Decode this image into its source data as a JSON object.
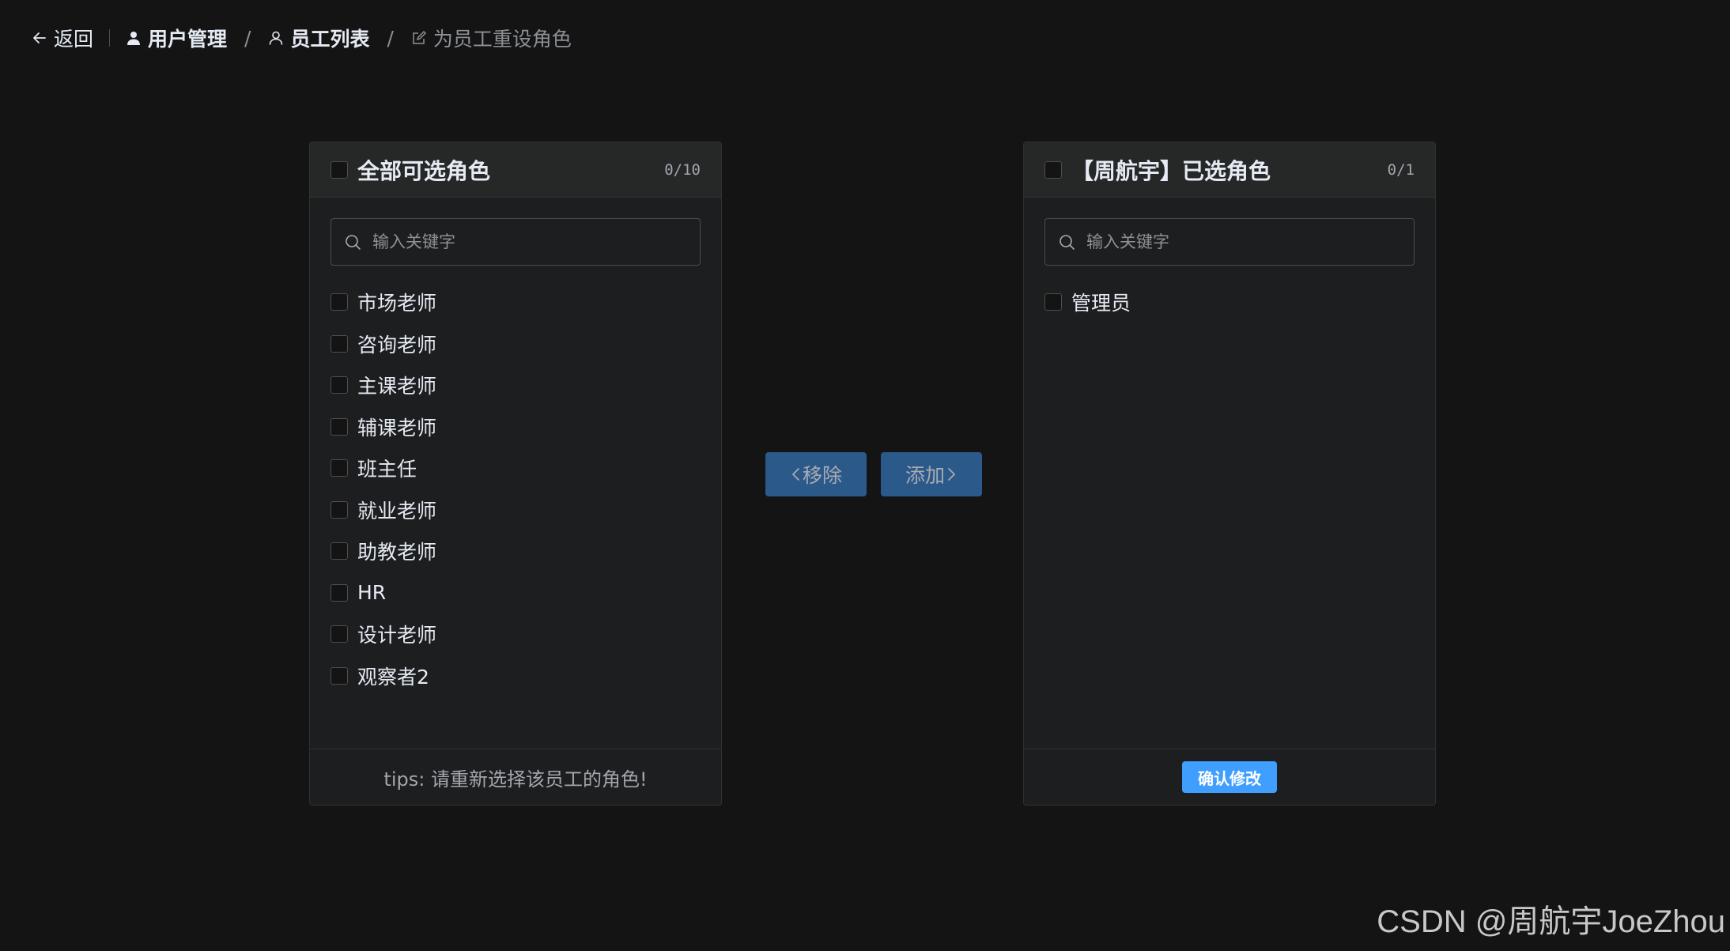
{
  "header": {
    "back_label": "返回",
    "breadcrumbs": [
      "用户管理",
      "员工列表",
      "为员工重设角色"
    ],
    "separator": "/"
  },
  "left_panel": {
    "title": "全部可选角色",
    "count": "0/10",
    "search_placeholder": "输入关键字",
    "items": [
      "市场老师",
      "咨询老师",
      "主课老师",
      "辅课老师",
      "班主任",
      "就业老师",
      "助教老师",
      "HR",
      "设计老师",
      "观察者2"
    ],
    "footer_tips": "tips: 请重新选择该员工的角色!"
  },
  "right_panel": {
    "title": "【周航宇】已选角色",
    "count": "0/1",
    "search_placeholder": "输入关键字",
    "items": [
      "管理员"
    ],
    "confirm_label": "确认修改"
  },
  "buttons": {
    "remove_label": "移除",
    "add_label": "添加"
  },
  "watermark": "CSDN @周航宇JoeZhou",
  "colors": {
    "background": "#141414",
    "panel": "#1d1e1f",
    "primary": "#409eff",
    "primary_disabled": "#2a598a"
  }
}
